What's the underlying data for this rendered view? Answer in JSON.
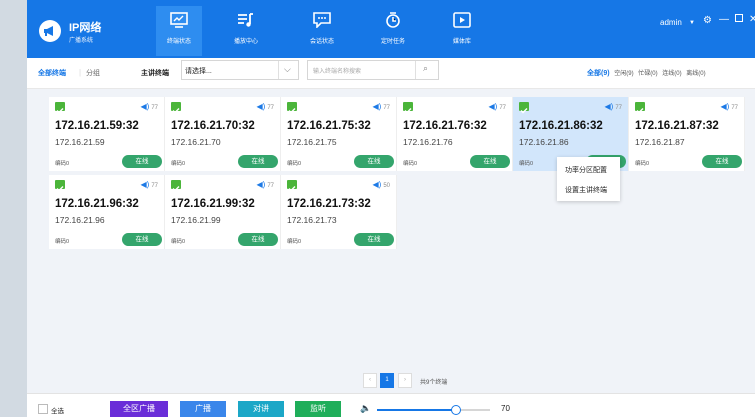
{
  "app": {
    "title": "IP网络",
    "subtitle": "广播系统"
  },
  "nav": [
    {
      "label": "终端状态",
      "icon": "monitor-icon",
      "active": true
    },
    {
      "label": "播放中心",
      "icon": "playlist-icon",
      "active": false
    },
    {
      "label": "会话状态",
      "icon": "chat-icon",
      "active": false
    },
    {
      "label": "定时任务",
      "icon": "timer-icon",
      "active": false
    },
    {
      "label": "媒体库",
      "icon": "media-icon",
      "active": false
    }
  ],
  "user": {
    "name": "admin"
  },
  "filter": {
    "all_terminals": "全部终端",
    "group": "分组",
    "main_terminal_label": "主讲终端",
    "select_placeholder": "请选择...",
    "search_placeholder": "输入终端名称搜索",
    "status_tabs": [
      "全部(9)",
      "空闲(9)",
      "忙碌(0)",
      "连线(0)",
      "离线(0)"
    ]
  },
  "terminals": [
    {
      "title": "172.16.21.59:32",
      "ip": "172.16.21.59",
      "volume": "77",
      "code": "编码0",
      "status": "在线"
    },
    {
      "title": "172.16.21.70:32",
      "ip": "172.16.21.70",
      "volume": "77",
      "code": "编码0",
      "status": "在线"
    },
    {
      "title": "172.16.21.75:32",
      "ip": "172.16.21.75",
      "volume": "77",
      "code": "编码0",
      "status": "在线"
    },
    {
      "title": "172.16.21.76:32",
      "ip": "172.16.21.76",
      "volume": "77",
      "code": "编码0",
      "status": "在线"
    },
    {
      "title": "172.16.21.86:32",
      "ip": "172.16.21.86",
      "volume": "77",
      "code": "编码0",
      "status": "在线"
    },
    {
      "title": "172.16.21.87:32",
      "ip": "172.16.21.87",
      "volume": "77",
      "code": "编码0",
      "status": "在线"
    },
    {
      "title": "172.16.21.96:32",
      "ip": "172.16.21.96",
      "volume": "77",
      "code": "编码0",
      "status": "在线"
    },
    {
      "title": "172.16.21.99:32",
      "ip": "172.16.21.99",
      "volume": "77",
      "code": "编码0",
      "status": "在线"
    },
    {
      "title": "172.16.21.73:32",
      "ip": "172.16.21.73",
      "volume": "50",
      "code": "编码0",
      "status": "在线"
    }
  ],
  "context_menu": [
    "功率分区配置",
    "设置主讲终端"
  ],
  "pagination": {
    "page": "1",
    "total": "共9个终端"
  },
  "bottom": {
    "select_all": "全选",
    "buttons": [
      "全区广播",
      "广播",
      "对讲",
      "监听"
    ],
    "volume": "70",
    "volume_level": 0.7
  },
  "colors": {
    "topbar": "#1677e6",
    "online": "#34a56c",
    "btn_all": "#6a2ed8",
    "btn_broadcast": "#3a86ea",
    "btn_talk": "#1ca7c7",
    "btn_listen": "#1fae5a"
  }
}
